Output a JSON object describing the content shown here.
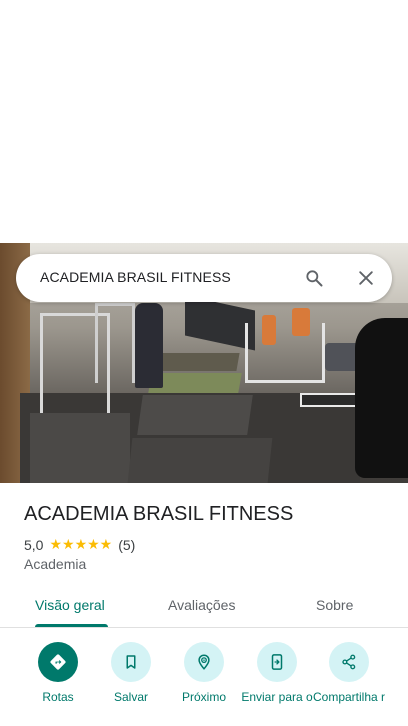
{
  "search": {
    "query": "ACADEMIA BRASIL FITNESS"
  },
  "place": {
    "title": "ACADEMIA BRASIL FITNESS",
    "rating": "5,0",
    "stars": "★★★★★",
    "review_count": "(5)",
    "category": "Academia"
  },
  "tabs": [
    {
      "label": "Visão geral",
      "active": true
    },
    {
      "label": "Avaliações",
      "active": false
    },
    {
      "label": "Sobre",
      "active": false
    }
  ],
  "actions": [
    {
      "label": "Rotas",
      "icon": "directions-icon"
    },
    {
      "label": "Salvar",
      "icon": "bookmark-icon"
    },
    {
      "label": "Próximo",
      "icon": "nearby-icon"
    },
    {
      "label": "Enviar para o",
      "icon": "send-to-phone-icon"
    },
    {
      "label": "Compartilha r",
      "icon": "share-icon"
    }
  ],
  "colors": {
    "accent": "#00796b",
    "action_bg": "#d4f3f5",
    "stars": "#fbbc04"
  }
}
